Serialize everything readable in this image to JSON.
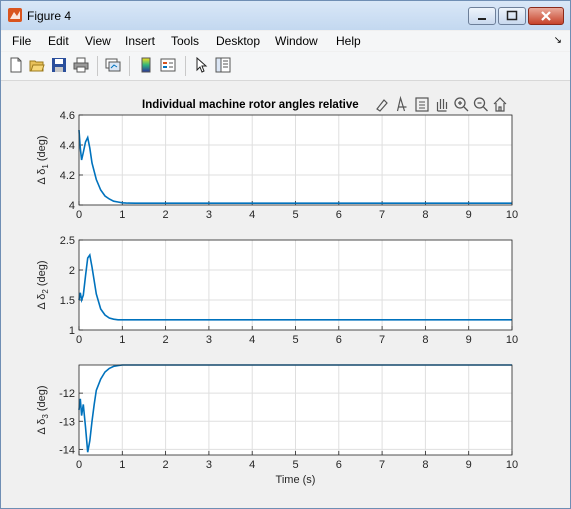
{
  "window": {
    "title": "Figure 4"
  },
  "menu": {
    "items": [
      "File",
      "Edit",
      "View",
      "Insert",
      "Tools",
      "Desktop",
      "Window",
      "Help"
    ]
  },
  "toolbar": {
    "icons": [
      "new-figure-icon",
      "open-file-icon",
      "save-icon",
      "print-icon",
      "link-plot-icon",
      "insert-colorbar-icon",
      "insert-legend-icon",
      "edit-plot-pointer-icon",
      "property-inspector-icon"
    ]
  },
  "axes_toolbar": {
    "icons": [
      "brush-icon",
      "data-tips-icon",
      "export-icon",
      "pan-icon",
      "zoom-in-icon",
      "zoom-out-icon",
      "home-icon"
    ]
  },
  "colors": {
    "line": "#0072bd",
    "grid": "#dfdfdf",
    "axes_bg": "#ffffff",
    "axes_edge": "#262626"
  },
  "chart_data": [
    {
      "type": "line",
      "title": "Individual machine rotor angles relative",
      "ylabel": "Δ δ",
      "ylabel_sub": "1",
      "ylabel_unit": "(deg)",
      "xlim": [
        0,
        10
      ],
      "ylim": [
        4,
        4.6
      ],
      "xticks": [
        "0",
        "1",
        "2",
        "3",
        "4",
        "5",
        "6",
        "7",
        "8",
        "9",
        "10"
      ],
      "yticks": [
        "4",
        "4.2",
        "4.4",
        "4.6"
      ],
      "ytick_values": [
        4,
        4.2,
        4.4,
        4.6
      ],
      "grid": true,
      "x": [
        0,
        0.03,
        0.06,
        0.1,
        0.15,
        0.2,
        0.25,
        0.3,
        0.4,
        0.5,
        0.6,
        0.7,
        0.8,
        0.9,
        1.0,
        1.1,
        1.3,
        1.6,
        2,
        10
      ],
      "y": [
        4.5,
        4.38,
        4.3,
        4.35,
        4.42,
        4.45,
        4.38,
        4.28,
        4.17,
        4.1,
        4.06,
        4.04,
        4.025,
        4.02,
        4.015,
        4.013,
        4.012,
        4.012,
        4.012,
        4.012
      ]
    },
    {
      "type": "line",
      "title": "",
      "ylabel": "Δ δ",
      "ylabel_sub": "2",
      "ylabel_unit": "(deg)",
      "xlim": [
        0,
        10
      ],
      "ylim": [
        1,
        2.5
      ],
      "xticks": [
        "0",
        "1",
        "2",
        "3",
        "4",
        "5",
        "6",
        "7",
        "8",
        "9",
        "10"
      ],
      "yticks": [
        "1",
        "1.5",
        "2",
        "2.5"
      ],
      "ytick_values": [
        1,
        1.5,
        2,
        2.5
      ],
      "grid": true,
      "x": [
        0,
        0.03,
        0.06,
        0.1,
        0.15,
        0.2,
        0.25,
        0.3,
        0.4,
        0.5,
        0.6,
        0.7,
        0.8,
        0.9,
        1.0,
        1.2,
        1.5,
        2,
        10
      ],
      "y": [
        1.5,
        1.62,
        1.5,
        1.58,
        1.9,
        2.2,
        2.25,
        2.05,
        1.6,
        1.35,
        1.25,
        1.2,
        1.18,
        1.17,
        1.17,
        1.17,
        1.17,
        1.17,
        1.17
      ]
    },
    {
      "type": "line",
      "title": "",
      "ylabel": "Δ δ",
      "ylabel_sub": "3",
      "ylabel_unit": "(deg)",
      "xlim": [
        0,
        10
      ],
      "ylim": [
        -14.2,
        -11
      ],
      "xticks": [
        "0",
        "1",
        "2",
        "3",
        "4",
        "5",
        "6",
        "7",
        "8",
        "9",
        "10"
      ],
      "yticks": [
        "-12",
        "-13",
        "-14"
      ],
      "ytick_values": [
        -12,
        -13,
        -14
      ],
      "grid": true,
      "xlabel": "Time (s)",
      "x": [
        0,
        0.03,
        0.06,
        0.1,
        0.15,
        0.2,
        0.25,
        0.3,
        0.35,
        0.4,
        0.5,
        0.6,
        0.7,
        0.8,
        0.9,
        1.0,
        1.2,
        1.5,
        2,
        10
      ],
      "y": [
        -12.6,
        -12.2,
        -12.8,
        -12.4,
        -13.2,
        -14.1,
        -13.7,
        -13.0,
        -12.4,
        -11.9,
        -11.5,
        -11.25,
        -11.12,
        -11.05,
        -11.02,
        -11.0,
        -11.0,
        -11.0,
        -11.0,
        -11.0
      ]
    }
  ]
}
